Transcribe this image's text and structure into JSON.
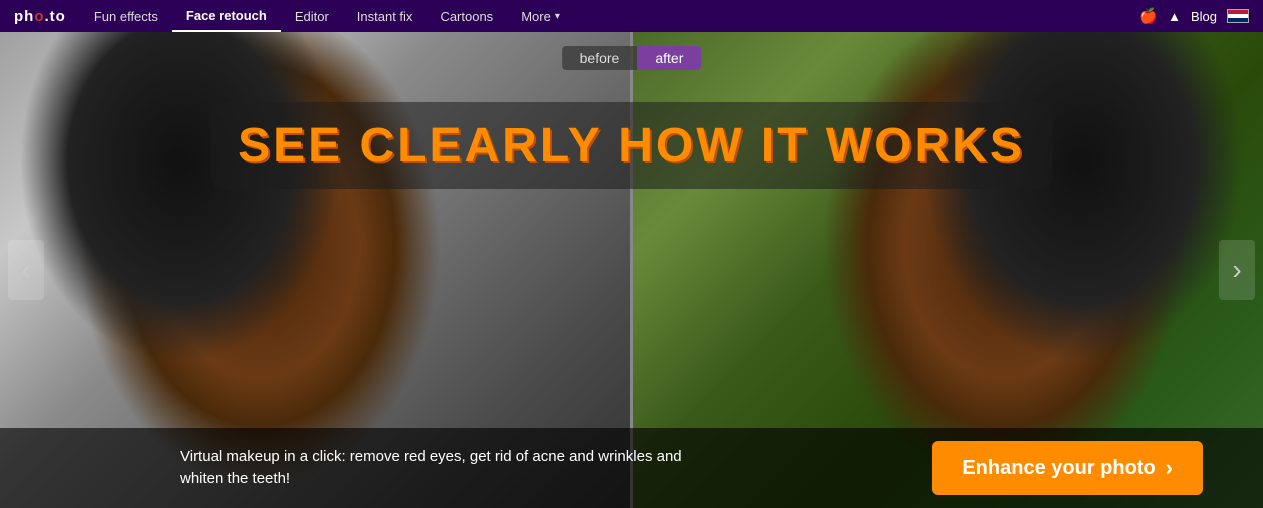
{
  "nav": {
    "logo": "pho.to",
    "items": [
      {
        "label": "Fun effects",
        "active": false
      },
      {
        "label": "Face retouch",
        "active": true
      },
      {
        "label": "Editor",
        "active": false
      },
      {
        "label": "Instant fix",
        "active": false
      },
      {
        "label": "Cartoons",
        "active": false
      },
      {
        "label": "More",
        "active": false,
        "dropdown": true
      }
    ],
    "right": {
      "apple_icon": "🍎",
      "android_icon": "⬡",
      "blog": "Blog"
    }
  },
  "hero": {
    "heading": "See clearly how it works",
    "before_label": "before",
    "after_label": "after"
  },
  "bottom": {
    "description": "Virtual makeup in a click: remove red eyes, get rid of acne and wrinkles and\nwhiten the teeth!",
    "cta_label": "Enhance your photo",
    "cta_chevron": "›"
  },
  "arrows": {
    "left": "‹",
    "right": "›"
  }
}
